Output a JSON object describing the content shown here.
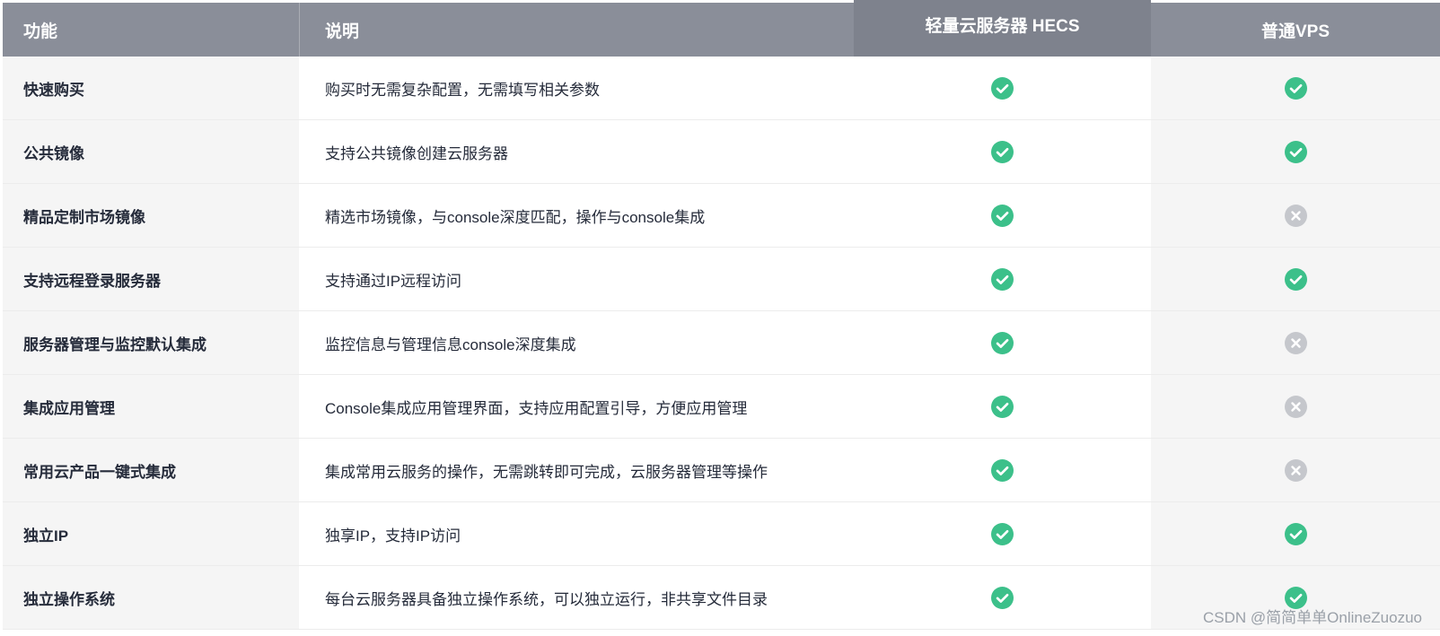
{
  "colors": {
    "header_bg": "#8a8e99",
    "check_green": "#3cc08a",
    "cross_gray": "#c5c7cc"
  },
  "header": {
    "feature": "功能",
    "description": "说明",
    "hecs": "轻量云服务器 HECS",
    "vps": "普通VPS"
  },
  "rows": [
    {
      "feature": "快速购买",
      "description": "购买时无需复杂配置，无需填写相关参数",
      "hecs": "check",
      "vps": "check"
    },
    {
      "feature": "公共镜像",
      "description": "支持公共镜像创建云服务器",
      "hecs": "check",
      "vps": "check"
    },
    {
      "feature": "精品定制市场镜像",
      "description": "精选市场镜像，与console深度匹配，操作与console集成",
      "hecs": "check",
      "vps": "cross"
    },
    {
      "feature": "支持远程登录服务器",
      "description": "支持通过IP远程访问",
      "hecs": "check",
      "vps": "check"
    },
    {
      "feature": "服务器管理与监控默认集成",
      "description": "监控信息与管理信息console深度集成",
      "hecs": "check",
      "vps": "cross"
    },
    {
      "feature": "集成应用管理",
      "description": "Console集成应用管理界面，支持应用配置引导，方便应用管理",
      "hecs": "check",
      "vps": "cross"
    },
    {
      "feature": "常用云产品一键式集成",
      "description": "集成常用云服务的操作，无需跳转即可完成，云服务器管理等操作",
      "hecs": "check",
      "vps": "cross"
    },
    {
      "feature": "独立IP",
      "description": "独享IP，支持IP访问",
      "hecs": "check",
      "vps": "check"
    },
    {
      "feature": "独立操作系统",
      "description": "每台云服务器具备独立操作系统，可以独立运行，非共享文件目录",
      "hecs": "check",
      "vps": "check"
    }
  ],
  "watermark": "CSDN @简简单单OnlineZuozuo"
}
